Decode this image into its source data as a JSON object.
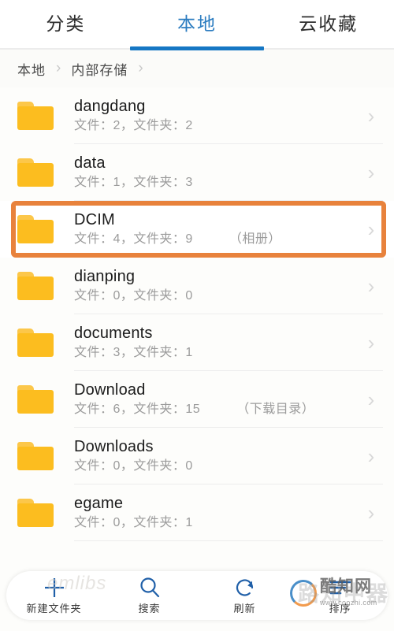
{
  "tabs": [
    {
      "label": "分类",
      "active": false
    },
    {
      "label": "本地",
      "active": true
    },
    {
      "label": "云收藏",
      "active": false
    }
  ],
  "breadcrumb": {
    "items": [
      "本地",
      "内部存储"
    ],
    "separator": "›"
  },
  "list": [
    {
      "name": "dangdang",
      "meta": "文件：2，文件夹：2",
      "note": "",
      "highlighted": false
    },
    {
      "name": "data",
      "meta": "文件：1，文件夹：3",
      "note": "",
      "highlighted": false
    },
    {
      "name": "DCIM",
      "meta": "文件：4，文件夹：9",
      "note": "（相册）",
      "highlighted": true
    },
    {
      "name": "dianping",
      "meta": "文件：0，文件夹：0",
      "note": "",
      "highlighted": false
    },
    {
      "name": "documents",
      "meta": "文件：3，文件夹：1",
      "note": "",
      "highlighted": false
    },
    {
      "name": "Download",
      "meta": "文件：6，文件夹：15",
      "note": "（下载目录）",
      "highlighted": false
    },
    {
      "name": "Downloads",
      "meta": "文件：0，文件夹：0",
      "note": "",
      "highlighted": false
    },
    {
      "name": "egame",
      "meta": "文件：0，文件夹：1",
      "note": "",
      "highlighted": false
    }
  ],
  "bottombar": [
    {
      "label": "新建文件夹",
      "icon": "plus-icon"
    },
    {
      "label": "搜索",
      "icon": "search-icon"
    },
    {
      "label": "刷新",
      "icon": "refresh-icon"
    },
    {
      "label": "排序",
      "icon": "sort-icon"
    }
  ],
  "watermarks": {
    "emlibs": "emlibs",
    "coozhi_name": "酷知网",
    "coozhi_url": "www.coozhi.com",
    "ghost": "路知中器"
  },
  "colors": {
    "accent_blue": "#1677c4",
    "folder_amber": "#fcbd1f",
    "highlight_orange": "#e8823c",
    "meta_gray": "#9b9b9b"
  },
  "icons": {
    "chevron_right": "›"
  }
}
